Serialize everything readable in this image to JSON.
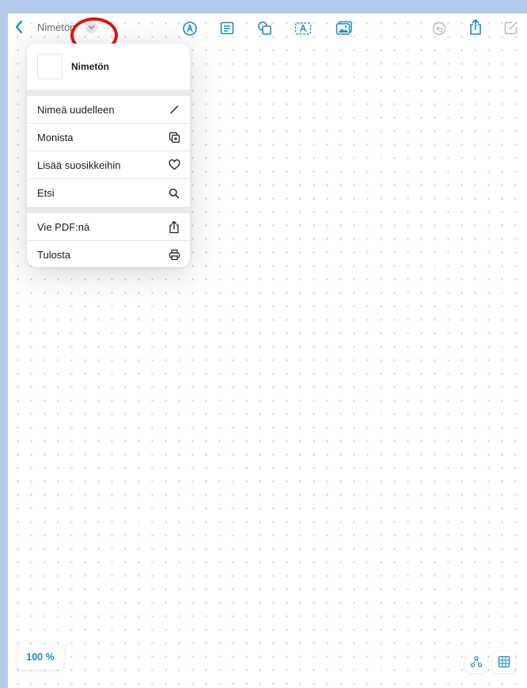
{
  "toolbar": {
    "title": "Nimetön",
    "icons": {
      "back": "chevron-left-icon",
      "title_menu": "chevron-down-icon",
      "pen": "pen-tool-icon",
      "note": "note-icon",
      "shapes": "shapes-icon",
      "textbox": "text-box-icon",
      "media": "media-icon",
      "undo": "undo-icon",
      "share": "share-icon",
      "new": "new-board-icon"
    }
  },
  "menu": {
    "header_title": "Nimetön",
    "items": [
      {
        "label": "Nimeä uudelleen",
        "icon": "pencil-icon"
      },
      {
        "label": "Monista",
        "icon": "duplicate-icon"
      },
      {
        "label": "Lisää suosikkeihin",
        "icon": "heart-icon"
      },
      {
        "label": "Etsi",
        "icon": "search-icon"
      },
      {
        "label": "Vie PDF:nä",
        "icon": "export-icon"
      },
      {
        "label": "Tulosta",
        "icon": "print-icon"
      }
    ]
  },
  "bottom": {
    "zoom": "100 %"
  },
  "colors": {
    "accent": "#1a8bbd",
    "highlight": "#e81010",
    "frame": "#b3cbe9"
  }
}
